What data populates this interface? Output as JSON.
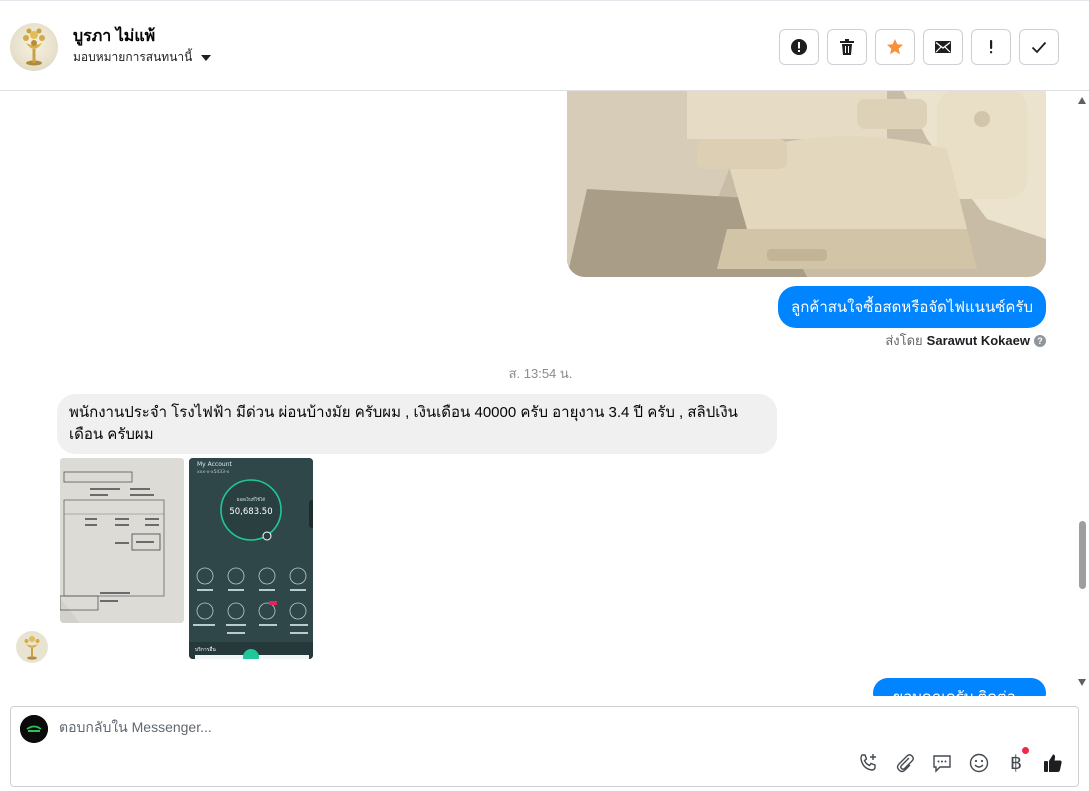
{
  "header": {
    "contact_name": "บูรภา ไม่แพ้",
    "assign_label": "มอบหมายการสนทนานี้",
    "actions": [
      {
        "icon": "alert-circle-icon",
        "name": "mark-spam-button"
      },
      {
        "icon": "trash-icon",
        "name": "delete-button"
      },
      {
        "icon": "star-icon",
        "name": "star-button",
        "color": "#f7923b"
      },
      {
        "icon": "envelope-icon",
        "name": "mark-unread-button"
      },
      {
        "icon": "exclamation-icon",
        "name": "follow-up-button"
      },
      {
        "icon": "check-icon",
        "name": "mark-done-button"
      }
    ]
  },
  "conversation": {
    "outgoing_message": "ลูกค้าสนใจซื้อสดหรือจัดไฟแนนซ์ครับ",
    "sent_by_prefix": "ส่งโดย",
    "sent_by_name": "Sarawut Kokaew",
    "timestamp": "ส. 13:54 น.",
    "incoming_message": "พนักงานประจำ โรงไฟฟ้า มีด่วน ผ่อนบ้างมัย ครับผม , เงินเดือน 40000 ครับ อายุงาน 3.4 ปี ครับ , สลิปเงินเดือน ครับผม",
    "attachment_2": {
      "account_title": "My Account",
      "account_number": "xxx-x-x5433-x",
      "balance_label": "ยอดเงินที่ใช้ได้",
      "balance": "50,683.50",
      "services_label": "บริการอื่น"
    },
    "partial_outgoing": "ขอบคุณครับ ติดต่อกลับ"
  },
  "composer": {
    "placeholder": "ตอบกลับใน Messenger...",
    "tools": [
      "phone-add-icon",
      "paperclip-icon",
      "saved-reply-icon",
      "emoji-icon",
      "baht-icon",
      "thumbs-up-icon"
    ],
    "baht_symbol": "฿"
  },
  "colors": {
    "accent": "#0084ff",
    "incoming_bubble": "#f0f0f0",
    "star": "#f7923b",
    "notification_dot": "#f02849"
  }
}
